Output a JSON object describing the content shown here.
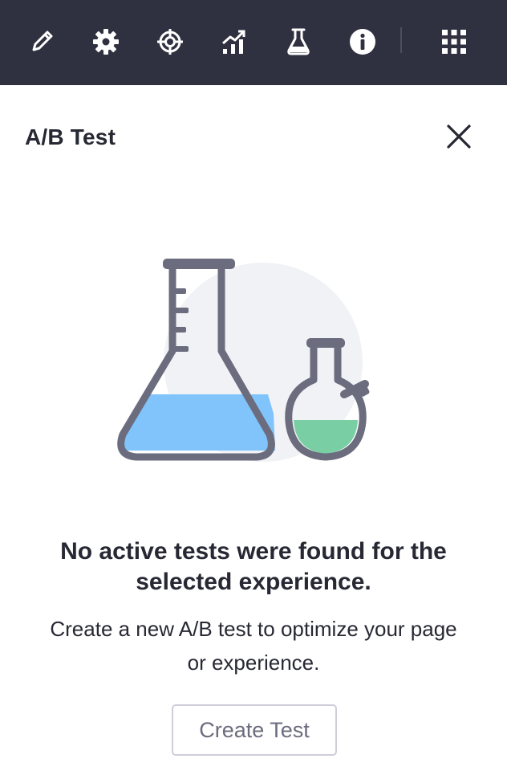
{
  "toolbar": {
    "icons": [
      {
        "name": "pencil-icon"
      },
      {
        "name": "gear-icon"
      },
      {
        "name": "target-icon"
      },
      {
        "name": "analytics-icon"
      },
      {
        "name": "flask-icon"
      },
      {
        "name": "info-icon"
      },
      {
        "name": "grid-icon"
      }
    ],
    "background_color": "#2f3140",
    "icon_color": "#ffffff"
  },
  "panel": {
    "title": "A/B Test",
    "close_icon": "close-icon"
  },
  "empty_state": {
    "illustration": "lab-flasks-icon",
    "title_line1": "No active tests were found for the",
    "title_line2": "selected experience.",
    "description_line1": "Create a new A/B test to optimize your page",
    "description_line2": "or experience.",
    "button_label": "Create Test",
    "colors": {
      "flask_outline": "#6b6c7e",
      "blue_liquid": "#80c4fb",
      "green_liquid": "#79cfa3",
      "background_circle": "#f1f2f5"
    }
  }
}
